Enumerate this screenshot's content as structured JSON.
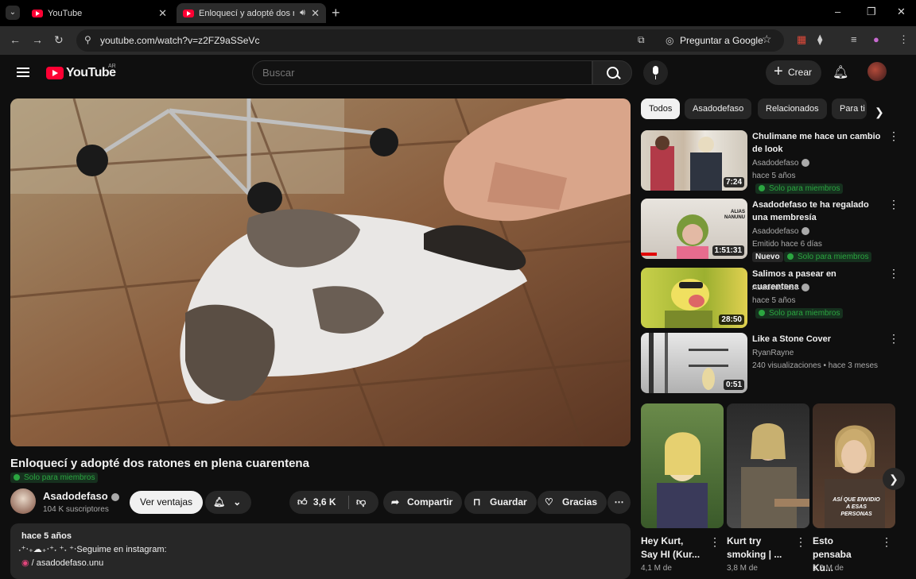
{
  "browser": {
    "tabs": [
      {
        "title": "YouTube"
      },
      {
        "title": "Enloquecí y adopté dos ratones"
      }
    ],
    "url": "youtube.com/watch?v=z2FZ9aSSeVc",
    "ask_label": "Preguntar a Google",
    "window_controls": [
      "–",
      "❐",
      "✕"
    ]
  },
  "yt": {
    "logo": "YouTube",
    "country": "AR",
    "search_placeholder": "Buscar",
    "create_label": "Crear"
  },
  "video": {
    "title": "Enloquecí y adopté dos ratones en plena cuarentena",
    "members_badge": "Solo para miembros",
    "channel": "Asadodefaso",
    "subscribers": "104 K suscriptores",
    "sales_label": "Ver ventajas",
    "likes": "3,6 K",
    "share_label": "Compartir",
    "save_label": "Guardar",
    "thanks_label": "Gracias",
    "desc_line1": "hace 5 años",
    "desc_line2": "˖⁺‧₊☁︎₊‧⁺˖ ⁺˖ ⁺‧Seguime en instagram:",
    "desc_line3": "/ asadodefaso.unu"
  },
  "sidebar": {
    "chips": [
      "Todos",
      "Asadodefaso",
      "Relacionados",
      "Para ti"
    ],
    "videos": [
      {
        "title": "Chulimane me hace un cambio de look",
        "channel": "Asadodefaso",
        "meta": "hace 5 años",
        "badge": "Solo para miembros",
        "duration": "7:24"
      },
      {
        "title": "Asadodefaso te ha regalado una membresía",
        "channel": "Asadodefaso",
        "meta": "Emitido hace 6 días",
        "badge": "Solo para miembros",
        "new_label": "Nuevo",
        "duration": "1:51:31"
      },
      {
        "title": "Salimos a pasear en cuarentena",
        "channel": "Asadodefaso",
        "meta": "hace 5 años",
        "badge": "Solo para miembros",
        "duration": "28:50"
      },
      {
        "title": "Like a Stone Cover",
        "channel": "RyanRayne",
        "meta": "240 visualizaciones • hace 3 meses",
        "duration": "0:51"
      }
    ],
    "shorts": [
      {
        "title": "Hey Kurt, Say HI (Kur...",
        "views": "4,1 M de"
      },
      {
        "title": "Kurt try smoking | ...",
        "views": "3,8 M de"
      },
      {
        "title": "Esto pensaba Ku...",
        "views": "1,2 M de",
        "overlay": "ASÍ QUE ENVIDIO A ESAS PERSONAS"
      }
    ]
  }
}
